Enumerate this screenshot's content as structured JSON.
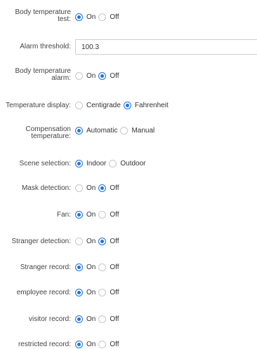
{
  "settings": {
    "body_temp_test": {
      "label_line1": "Body temperature",
      "label_line2": "test:",
      "options": [
        "On",
        "Off"
      ],
      "selected": "On"
    },
    "alarm_threshold": {
      "label": "Alarm threshold:",
      "value": "100.3"
    },
    "body_temp_alarm": {
      "label_line1": "Body temperature",
      "label_line2": "alarm:",
      "options": [
        "On",
        "Off"
      ],
      "selected": "Off"
    },
    "temperature_display": {
      "label": "Temperature display:",
      "options": [
        "Centigrade",
        "Fahrenheit"
      ],
      "selected": "Fahrenheit"
    },
    "compensation_temperature": {
      "label_line1": "Compensation",
      "label_line2": "temperature:",
      "options": [
        "Automatic",
        "Manual"
      ],
      "selected": "Automatic"
    },
    "scene_selection": {
      "label": "Scene selection:",
      "options": [
        "Indoor",
        "Outdoor"
      ],
      "selected": "Indoor"
    },
    "mask_detection": {
      "label": "Mask detection:",
      "options": [
        "On",
        "Off"
      ],
      "selected": "Off"
    },
    "fan": {
      "label": "Fan:",
      "options": [
        "On",
        "Off"
      ],
      "selected": "On"
    },
    "stranger_detection": {
      "label": "Stranger detection:",
      "options": [
        "On",
        "Off"
      ],
      "selected": "Off"
    },
    "stranger_record": {
      "label": "Stranger record:",
      "options": [
        "On",
        "Off"
      ],
      "selected": "On"
    },
    "employee_record": {
      "label": "employee record:",
      "options": [
        "On",
        "Off"
      ],
      "selected": "On"
    },
    "visitor_record": {
      "label": "visitor record:",
      "options": [
        "On",
        "Off"
      ],
      "selected": "On"
    },
    "restricted_record": {
      "label": "restricted record:",
      "options": [
        "On",
        "Off"
      ],
      "selected": "On"
    }
  },
  "colors": {
    "accent": "#1a73e8",
    "radio_border": "#c8c8c8",
    "text": "#333333"
  }
}
